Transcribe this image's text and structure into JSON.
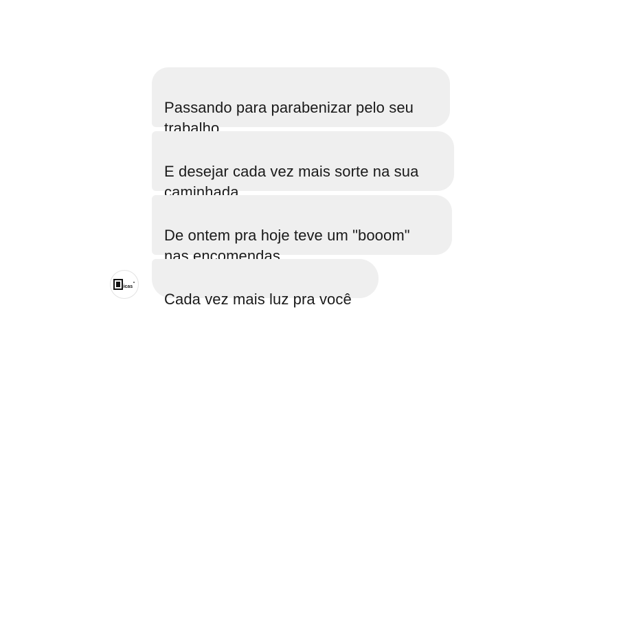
{
  "conversation": {
    "messages": [
      {
        "text": "Passando para parabenizar pelo seu\ntrabalho"
      },
      {
        "text": "E desejar cada vez mais sorte na sua\ncaminhada"
      },
      {
        "text": "De ontem pra hoje teve um \"booom\"\nnas encomendas"
      },
      {
        "text": "Cada vez mais luz pra você"
      }
    ],
    "sender": {
      "avatar_logo_text": "Dicas",
      "avatar_icon": "sender-logo-avatar"
    }
  },
  "colors": {
    "bubble_background": "#efefef",
    "text": "#1a1a1a",
    "page_background": "#ffffff"
  }
}
